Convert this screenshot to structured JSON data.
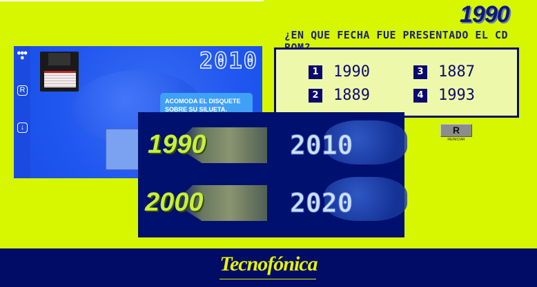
{
  "header": {
    "era_logo": "1990"
  },
  "quiz": {
    "question": "¿EN QUE FECHA FUE PRESENTADO EL CD ROM?",
    "options": [
      {
        "num": "1",
        "value": "1990"
      },
      {
        "num": "2",
        "value": "1889"
      },
      {
        "num": "3",
        "value": "1887"
      },
      {
        "num": "4",
        "value": "1993"
      }
    ],
    "reset_button": "R",
    "reset_label": "REINICIAR"
  },
  "preview": {
    "year": "2010",
    "instruction": "ACOMODA EL DISQUETE SOBRE SU SILUETA.",
    "side_r": "R",
    "side_down": "↓"
  },
  "eras": [
    "1990",
    "2010",
    "2000",
    "2020"
  ],
  "footer": {
    "brand": "Tecnofónica"
  },
  "colors": {
    "background": "#d6f700",
    "navy": "#00106e",
    "footer": "#000c66"
  }
}
